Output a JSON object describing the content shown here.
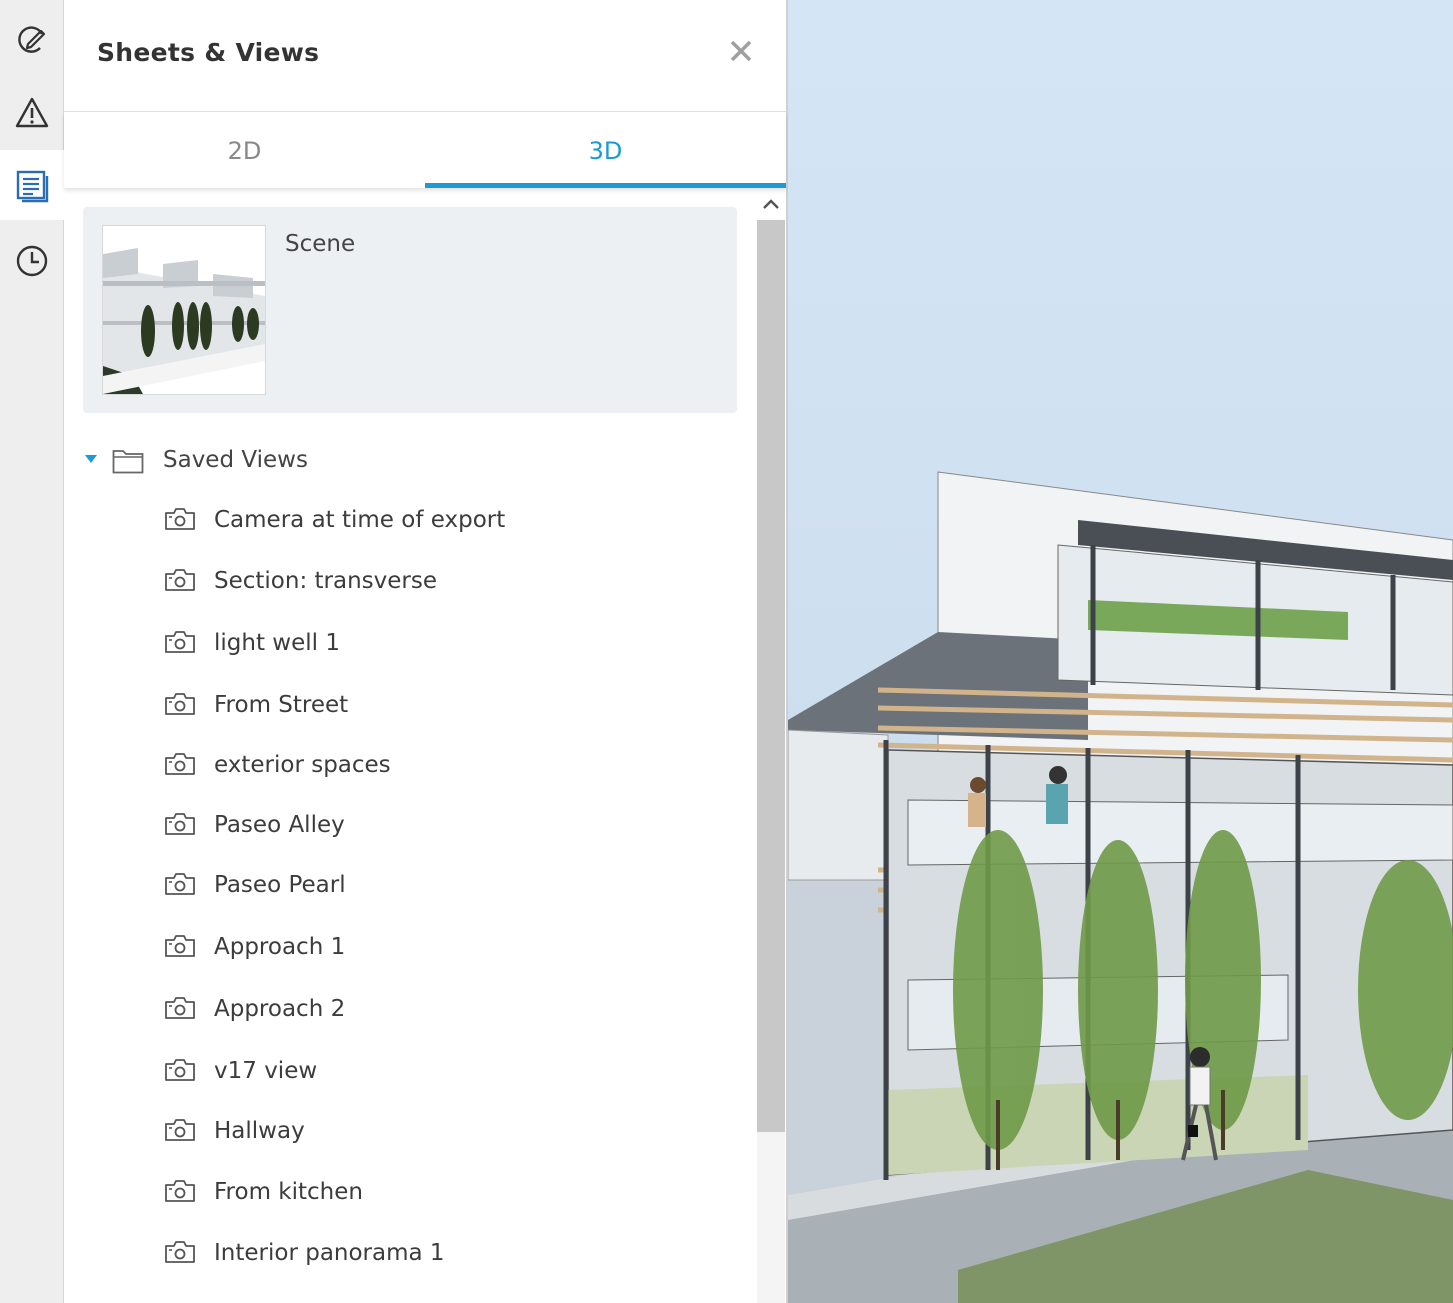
{
  "rail": {
    "items": [
      {
        "name": "markup-icon"
      },
      {
        "name": "issues-icon"
      },
      {
        "name": "sheets-views-icon",
        "active": true
      },
      {
        "name": "history-icon"
      }
    ]
  },
  "panel": {
    "title": "Sheets & Views",
    "tabs": [
      {
        "label": "2D",
        "active": false
      },
      {
        "label": "3D",
        "active": true
      }
    ],
    "scene": {
      "label": "Scene"
    },
    "group": {
      "label": "Saved Views",
      "expanded": true
    },
    "views": [
      "Camera at time of export",
      "Section: transverse",
      "light well 1",
      "From Street",
      "exterior spaces",
      "Paseo Alley",
      "Paseo Pearl",
      "Approach 1",
      "Approach 2",
      "v17 view",
      "Hallway",
      "From kitchen",
      "Interior panorama 1"
    ]
  },
  "colors": {
    "accent": "#1d9ad6",
    "rail_bg": "#eeeeee",
    "card_bg": "#edf0f3"
  }
}
